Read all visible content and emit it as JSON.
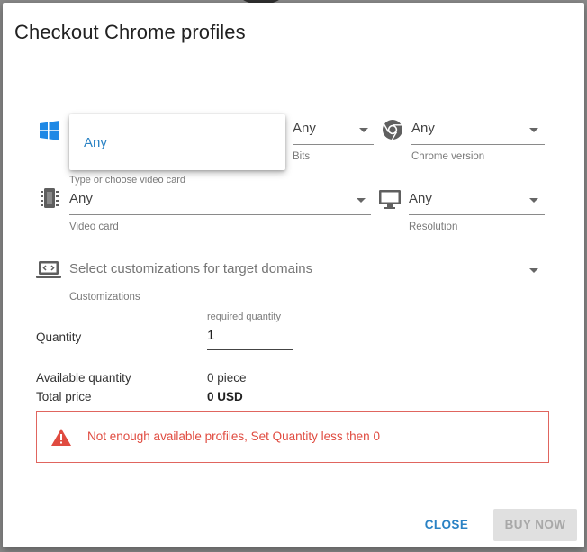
{
  "dialog": {
    "title": "Checkout Chrome profiles"
  },
  "os_field": {
    "icon": "windows-icon",
    "menu_option": "Any"
  },
  "bits_field": {
    "value": "Any",
    "label": "Bits"
  },
  "chrome_version_field": {
    "icon": "chrome-icon",
    "value": "Any",
    "label": "Chrome version"
  },
  "video_card_field": {
    "icon": "video-card-icon",
    "hint": "Type or choose video card",
    "value": "Any",
    "label": "Video card"
  },
  "resolution_field": {
    "icon": "monitor-icon",
    "value": "Any",
    "label": "Resolution"
  },
  "customizations_field": {
    "icon": "laptop-code-icon",
    "placeholder": "Select customizations for target domains",
    "label": "Customizations"
  },
  "quantity": {
    "label": "Quantity",
    "hint": "required quantity",
    "value": "1"
  },
  "summary": {
    "available_label": "Available quantity",
    "available_value": "0 piece",
    "total_label": "Total price",
    "total_value": "0 USD"
  },
  "error": {
    "icon": "warning-icon",
    "message": "Not enough available profiles, Set Quantity less then 0",
    "color": "#e04b40"
  },
  "actions": {
    "close_label": "CLOSE",
    "buy_label": "BUY NOW"
  },
  "colors": {
    "accent": "#2a82c4",
    "windows_blue": "#1e88e5",
    "error_border": "#e0655e"
  }
}
